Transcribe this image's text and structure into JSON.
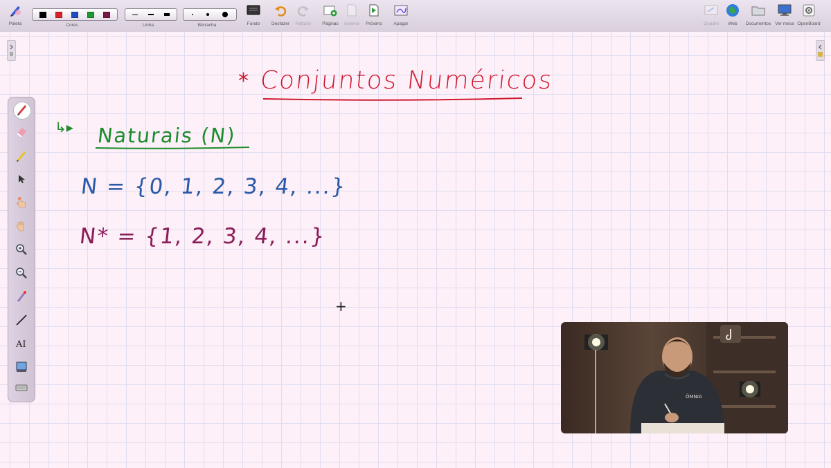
{
  "toolbar": {
    "left_buttons": [
      {
        "label": "Paleta",
        "icon": "palette-pen-icon"
      }
    ],
    "groups": {
      "colors_label": "Cores",
      "colors": [
        "#000000",
        "#d8232a",
        "#1e4fc2",
        "#1d9a36",
        "#7a1746"
      ],
      "line_label": "Linha",
      "eraser_label": "Borracha"
    },
    "buttons": [
      {
        "label": "Fundo",
        "icon": "background-icon",
        "enabled": true
      },
      {
        "label": "Desfazer",
        "icon": "undo-icon",
        "enabled": true
      },
      {
        "label": "Refazer",
        "icon": "redo-icon",
        "enabled": false
      },
      {
        "label": "Páginas",
        "icon": "add-page-icon",
        "enabled": true
      },
      {
        "label": "Anterior",
        "icon": "previous-page-icon",
        "enabled": false
      },
      {
        "label": "Próximo",
        "icon": "next-page-icon",
        "enabled": true
      },
      {
        "label": "Apagar",
        "icon": "erase-all-icon",
        "enabled": true
      }
    ],
    "right_buttons": [
      {
        "label": "Quadro",
        "icon": "board-icon",
        "enabled": false
      },
      {
        "label": "Web",
        "icon": "globe-icon",
        "enabled": true
      },
      {
        "label": "Documentos",
        "icon": "folder-icon",
        "enabled": true
      },
      {
        "label": "Ver mesa",
        "icon": "desktop-icon",
        "enabled": true
      },
      {
        "label": "OpenBoard",
        "icon": "settings-gear-icon",
        "enabled": true
      }
    ]
  },
  "tools": [
    "pen-tool-icon",
    "eraser-tool-icon",
    "highlighter-tool-icon",
    "selector-tool-icon",
    "pointer-hand-tool-icon",
    "hand-grab-tool-icon",
    "zoom-in-tool-icon",
    "zoom-out-tool-icon",
    "laser-pointer-tool-icon",
    "line-tool-icon",
    "text-tool-icon",
    "capture-tool-icon",
    "keyboard-tool-icon"
  ],
  "board": {
    "title_star": "*",
    "title": "Conjuntos Numéricos",
    "arrow": "↳▸",
    "section": "Naturais (N)",
    "set_naturals": "N = {0, 1, 2, 3, 4, ...}",
    "set_naturals_nonzero": "N* = {1, 2, 3, 4, ...}",
    "cursor": "+"
  },
  "colors": {
    "title": "#d0182f",
    "section": "#1d8c2c",
    "set_naturals": "#2a59a8",
    "set_naturals_nonzero": "#8a1c57",
    "board_bg": "#fdf0f8",
    "grid": "#e0ddf0"
  }
}
